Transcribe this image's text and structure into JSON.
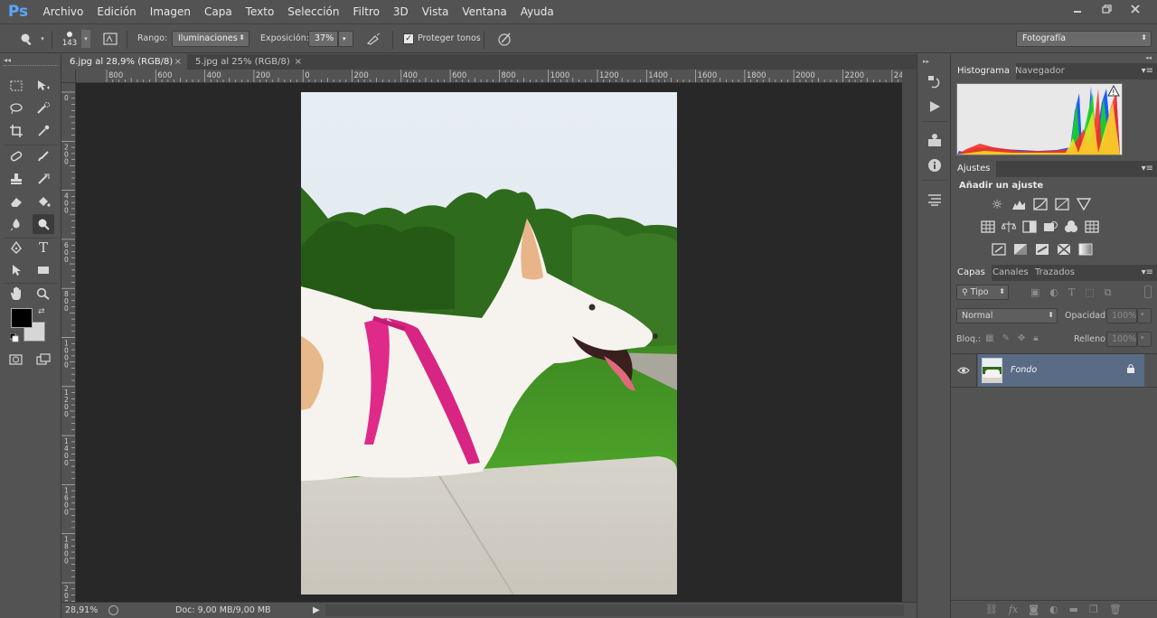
{
  "app": {
    "logo": "Ps"
  },
  "menu": [
    "Archivo",
    "Edición",
    "Imagen",
    "Capa",
    "Texto",
    "Selección",
    "Filtro",
    "3D",
    "Vista",
    "Ventana",
    "Ayuda"
  ],
  "window_controls": [
    "minimize",
    "restore",
    "close"
  ],
  "options": {
    "brush_size": "143",
    "range_label": "Rango:",
    "range_value": "Iluminaciones",
    "exposure_label": "Exposición:",
    "exposure_value": "37%",
    "protect_label": "Proteger tonos",
    "protect_checked": true,
    "workspace": "Fotografía"
  },
  "documents": {
    "tabs": [
      {
        "label": "6.jpg al 28,9% (RGB/8)",
        "active": true
      },
      {
        "label": "5.jpg al 25% (RGB/8)",
        "active": false
      }
    ],
    "ruler_h_ticks": [
      "800",
      "600",
      "400",
      "200",
      "0",
      "200",
      "400",
      "600",
      "800",
      "1000",
      "1200",
      "1400",
      "1600",
      "1800",
      "2000",
      "2200",
      "24"
    ],
    "ruler_v_ticks": [
      "0",
      "200",
      "400",
      "600",
      "800",
      "1000",
      "1200",
      "1400",
      "1600",
      "1800",
      "2000"
    ]
  },
  "status": {
    "zoom": "28,91%",
    "doc": "Doc: 9,00 MB/9,00 MB"
  },
  "panels": {
    "histogram_tabs": [
      "Histograma",
      "Navegador"
    ],
    "adjustments_tab": "Ajustes",
    "adjustments_heading": "Añadir un ajuste",
    "layers_tabs": [
      "Capas",
      "Canales",
      "Trazados"
    ],
    "layer_filter": "Tipo",
    "blend_mode": "Normal",
    "opacity_label": "Opacidad:",
    "opacity_value": "100%",
    "lock_label": "Bloq.:",
    "fill_label": "Relleno:",
    "fill_value": "100%",
    "layers": [
      {
        "name": "Fondo",
        "visible": true,
        "locked": true
      }
    ]
  },
  "colors": {
    "foreground": "#000000",
    "background": "#d6d6d6",
    "ps_blue": "#5aa6ff",
    "layer_selected": "#5a6b85"
  }
}
